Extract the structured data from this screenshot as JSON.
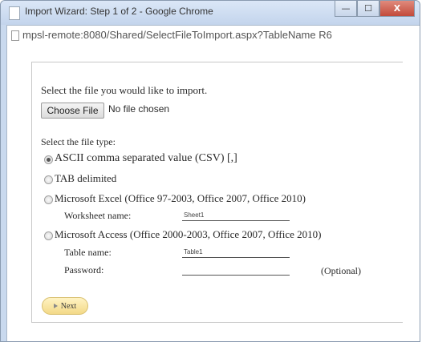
{
  "window": {
    "title": "Import Wizard: Step 1 of 2 - Google Chrome",
    "controls": {
      "minimize": "—",
      "maximize": "☐",
      "close": "X"
    },
    "icons": {
      "app": "page-icon"
    }
  },
  "address": {
    "url": "mpsl-remote:8080/Shared/SelectFileToImport.aspx?TableName R6"
  },
  "form": {
    "select_file_prompt": "Select the file you would like to import.",
    "choose_file_label": "Choose File",
    "no_file_text": "No file chosen",
    "file_type_heading": "Select the file type:",
    "options": [
      {
        "label": "ASCII comma separated value (CSV) [,]",
        "checked": true
      },
      {
        "label": "TAB delimited",
        "checked": false
      },
      {
        "label": "Microsoft Excel (Office 97-2003, Office 2007, Office 2010)",
        "checked": false
      },
      {
        "label": "Microsoft Access (Office 2000-2003, Office 2007, Office 2010)",
        "checked": false
      }
    ],
    "worksheet_label": "Worksheet name:",
    "worksheet_value": "Sheet1",
    "table_label": "Table name:",
    "table_value": "Table1",
    "password_label": "Password:",
    "password_value": "",
    "optional_note": "(Optional)",
    "next_label": "Next"
  },
  "colors": {
    "titlebar": "#c9d9ee",
    "close": "#c24a3a",
    "next_button": "#f3d987"
  }
}
